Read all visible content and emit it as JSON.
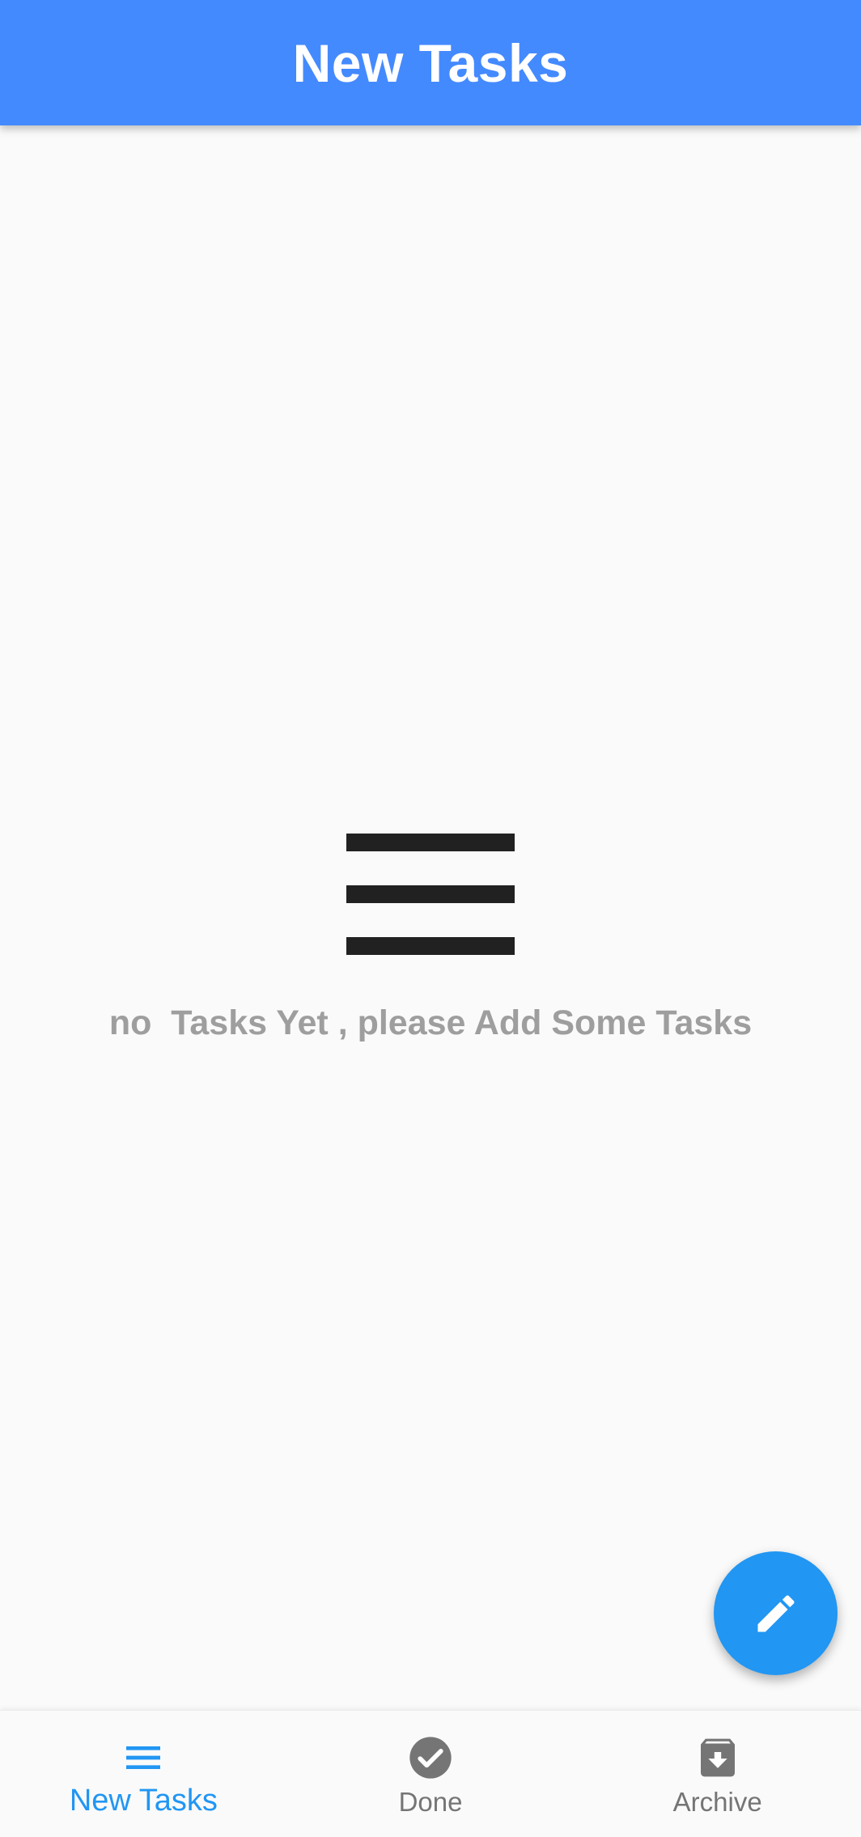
{
  "app_bar": {
    "title": "New Tasks"
  },
  "empty_state": {
    "icon": "menu-icon",
    "message": "no  Tasks Yet , please Add Some Tasks"
  },
  "fab": {
    "icon": "edit-pencil-icon",
    "color": "#2196f3"
  },
  "bottom_nav": {
    "active_index": 0,
    "active_color": "#2196f3",
    "inactive_color": "#757575",
    "items": [
      {
        "label": "New Tasks",
        "icon": "menu-icon"
      },
      {
        "label": "Done",
        "icon": "check-circle-icon"
      },
      {
        "label": "Archive",
        "icon": "archive-icon"
      }
    ]
  },
  "colors": {
    "app_bar": "#448aff",
    "background": "#fafafa",
    "muted_text": "#9e9e9e"
  }
}
